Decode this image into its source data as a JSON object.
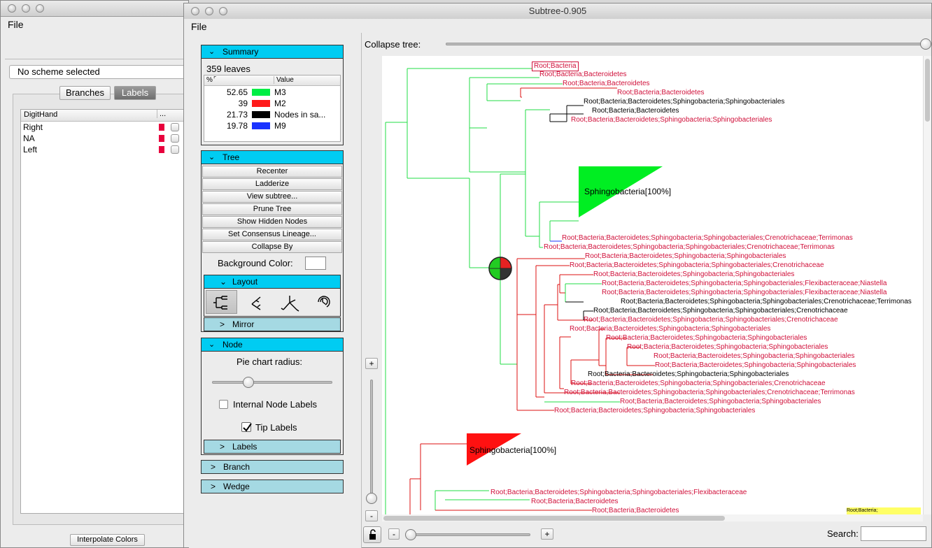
{
  "back_window": {
    "menu_file": "File",
    "scheme_select": "No scheme selected",
    "tab_branches": "Branches",
    "tab_labels": "Labels",
    "table_header": "DigitHand",
    "table_header_more": "...",
    "rows": [
      "Right",
      "NA",
      "Left"
    ],
    "row_color": "#e8003c",
    "interpolate_button": "Interpolate Colors"
  },
  "main_window": {
    "title": "Subtree-0.905",
    "menu_file": "File",
    "summary": {
      "header": "Summary",
      "leaves": "359 leaves",
      "col_pct": "%",
      "col_value": "Value",
      "rows": [
        {
          "pct": "52.65",
          "color": "#00ee44",
          "label": "M3"
        },
        {
          "pct": "39",
          "color": "#ff1a1a",
          "label": "M2"
        },
        {
          "pct": "21.73",
          "color": "#000000",
          "label": "Nodes in sa..."
        },
        {
          "pct": "19.78",
          "color": "#1a33ff",
          "label": "M9"
        }
      ]
    },
    "tree_panel": {
      "header": "Tree",
      "buttons": [
        "Recenter",
        "Ladderize",
        "View subtree...",
        "Prune Tree",
        "Show Hidden Nodes",
        "Set Consensus Lineage...",
        "Collapse By"
      ],
      "background_color_label": "Background Color:",
      "layout_header": "Layout",
      "layout_icons": [
        "rectangular-layout-icon",
        "slanted-layout-icon",
        "radial-layout-icon",
        "circular-layout-icon"
      ],
      "mirror_header": "Mirror"
    },
    "node_panel": {
      "header": "Node",
      "pie_chart_radius": "Pie chart radius:",
      "pie_chart_radius_value": 0.3,
      "internal_node_labels": "Internal Node Labels",
      "internal_node_labels_checked": false,
      "tip_labels": "Tip Labels",
      "tip_labels_checked": true,
      "labels_header": "Labels"
    },
    "branch_header": "Branch",
    "wedge_header": "Wedge",
    "collapse_tree_label": "Collapse tree:",
    "collapse_tree_value": 1.0,
    "search_label": "Search:",
    "search_value": "",
    "zoom_minus": "-",
    "zoom_plus": "+",
    "vzoom_plus": "+",
    "vzoom_minus": "-",
    "tree": {
      "wedge1_label": "Sphingobacteria[100%]",
      "wedge2_label": "Sphingobacteria[100%]",
      "corner_label": "Root;Bacteria;",
      "tips": [
        {
          "text": "Root;Bacteria",
          "color": "#d0103a"
        },
        {
          "text": "Root;Bacteria;Bacteroidetes",
          "color": "#d0103a"
        },
        {
          "text": "Root;Bacteria;Bacteroidetes",
          "color": "#d0103a"
        },
        {
          "text": "Root;Bacteria;Bacteroidetes",
          "color": "#d0103a"
        },
        {
          "text": "Root;Bacteria;Bacteroidetes;Sphingobacteria;Sphingobacteriales",
          "color": "#000000"
        },
        {
          "text": "Root;Bacteria;Bacteroidetes",
          "color": "#000000"
        },
        {
          "text": "Root;Bacteria;Bacteroidetes;Sphingobacteria;Sphingobacteriales",
          "color": "#d0103a"
        },
        {
          "text": "Root;Bacteria;Bacteroidetes;Sphingobacteria;Sphingobacteriales;Crenotrichaceae;Terrimonas",
          "color": "#d0103a"
        },
        {
          "text": "Root;Bacteria;Bacteroidetes;Sphingobacteria;Sphingobacteriales;Crenotrichaceae;Terrimonas",
          "color": "#d0103a"
        },
        {
          "text": "Root;Bacteria;Bacteroidetes;Sphingobacteria;Sphingobacteriales",
          "color": "#d0103a"
        },
        {
          "text": "Root;Bacteria;Bacteroidetes;Sphingobacteria;Sphingobacteriales;Crenotrichaceae",
          "color": "#d0103a"
        },
        {
          "text": "Root;Bacteria;Bacteroidetes;Sphingobacteria;Sphingobacteriales",
          "color": "#d0103a"
        },
        {
          "text": "Root;Bacteria;Bacteroidetes;Sphingobacteria;Sphingobacteriales;Flexibacteraceae;Niastella",
          "color": "#d0103a"
        },
        {
          "text": "Root;Bacteria;Bacteroidetes;Sphingobacteria;Sphingobacteriales;Flexibacteraceae;Niastella",
          "color": "#d0103a"
        },
        {
          "text": "Root;Bacteria;Bacteroidetes;Sphingobacteria;Sphingobacteriales;Crenotrichaceae;Terrimonas",
          "color": "#000000"
        },
        {
          "text": "Root;Bacteria;Bacteroidetes;Sphingobacteria;Sphingobacteriales;Crenotrichaceae",
          "color": "#000000"
        },
        {
          "text": "Root;Bacteria;Bacteroidetes;Sphingobacteria;Sphingobacteriales;Crenotrichaceae",
          "color": "#d0103a"
        },
        {
          "text": "Root;Bacteria;Bacteroidetes;Sphingobacteria;Sphingobacteriales",
          "color": "#d0103a"
        },
        {
          "text": "Root;Bacteria;Bacteroidetes;Sphingobacteria;Sphingobacteriales",
          "color": "#d0103a"
        },
        {
          "text": "Root;Bacteria;Bacteroidetes;Sphingobacteria;Sphingobacteriales",
          "color": "#d0103a"
        },
        {
          "text": "Root;Bacteria;Bacteroidetes;Sphingobacteria;Sphingobacteriales",
          "color": "#d0103a"
        },
        {
          "text": "Root;Bacteria;Bacteroidetes;Sphingobacteria;Sphingobacteriales",
          "color": "#d0103a"
        },
        {
          "text": "Root;Bacteria;Bacteroidetes;Sphingobacteria;Sphingobacteriales",
          "color": "#000000"
        },
        {
          "text": "Root;Bacteria;Bacteroidetes;Sphingobacteria;Sphingobacteriales;Crenotrichaceae",
          "color": "#d0103a"
        },
        {
          "text": "Root;Bacteria;Bacteroidetes;Sphingobacteria;Sphingobacteriales;Crenotrichaceae;Terrimonas",
          "color": "#d0103a"
        },
        {
          "text": "Root;Bacteria;Bacteroidetes;Sphingobacteria;Sphingobacteriales",
          "color": "#d0103a"
        },
        {
          "text": "Root;Bacteria;Bacteroidetes;Sphingobacteria;Sphingobacteriales",
          "color": "#d0103a"
        },
        {
          "text": "Root;Bacteria;Bacteroidetes;Sphingobacteria;Sphingobacteriales;Flexibacteraceae",
          "color": "#d0103a"
        },
        {
          "text": "Root;Bacteria;Bacteroidetes",
          "color": "#d0103a"
        },
        {
          "text": "Root;Bacteria;Bacteroidetes",
          "color": "#d0103a"
        }
      ]
    }
  }
}
